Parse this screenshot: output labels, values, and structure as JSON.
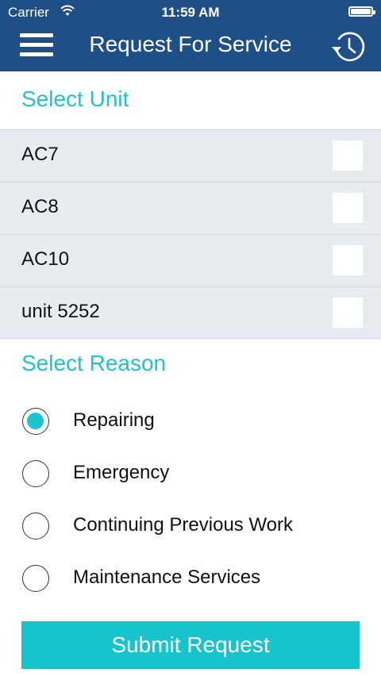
{
  "status_bar": {
    "carrier": "Carrier",
    "time": "11:59 AM"
  },
  "header": {
    "title": "Request For Service",
    "menu_icon": "hamburger-menu-icon",
    "history_icon": "history-clock-icon"
  },
  "units": {
    "title": "Select Unit",
    "items": [
      {
        "label": "AC7",
        "checked": false
      },
      {
        "label": "AC8",
        "checked": false
      },
      {
        "label": "AC10",
        "checked": false
      },
      {
        "label": "unit 5252",
        "checked": false
      }
    ]
  },
  "reasons": {
    "title": "Select Reason",
    "items": [
      {
        "label": "Repairing",
        "selected": true
      },
      {
        "label": "Emergency",
        "selected": false
      },
      {
        "label": "Continuing Previous Work",
        "selected": false
      },
      {
        "label": "Maintenance Services",
        "selected": false
      }
    ]
  },
  "submit_label": "Submit Request",
  "colors": {
    "header_bg": "#1e4f86",
    "accent": "#1cc4cd",
    "list_bg": "#e8ecf1"
  }
}
